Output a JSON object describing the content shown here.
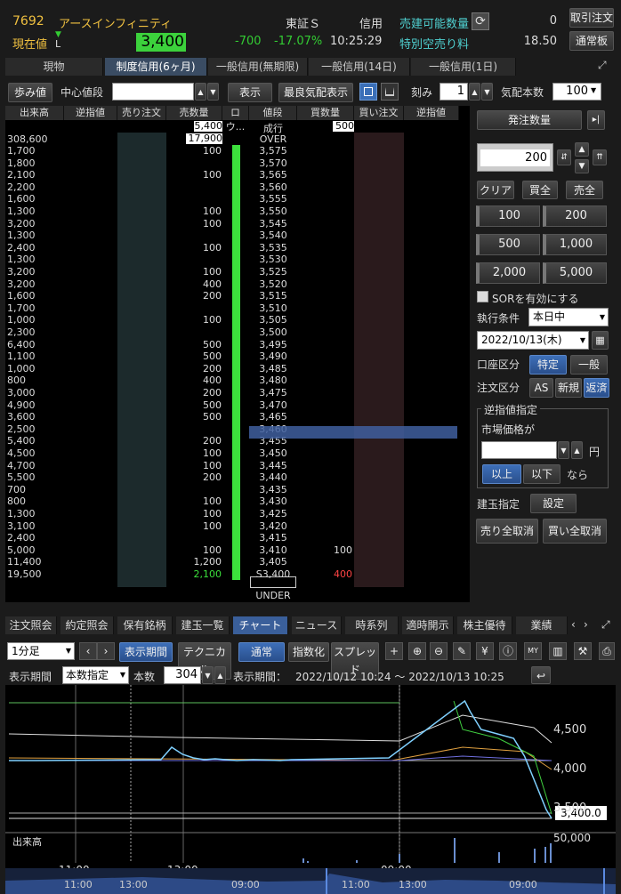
{
  "header": {
    "code": "7692",
    "name": "アースインフィニティ",
    "market": "東証Ｓ",
    "type": "信用",
    "sellable_label": "売建可能数量",
    "sellable_value": "0",
    "fee_label": "特別空売り料",
    "fee_value": "18.50",
    "price_label": "現在値",
    "price_flag": "L",
    "price": "3,400",
    "change": "-700",
    "change_pct": "-17.07%",
    "time": "10:25:29",
    "btn_trade": "取引注文",
    "btn_normal": "通常板"
  },
  "tabs": [
    "現物",
    "制度信用(6ヶ月)",
    "一般信用(無期限)",
    "一般信用(14日)",
    "一般信用(1日)"
  ],
  "toolbar": {
    "ayumi": "歩み値",
    "center_label": "中心値段",
    "show": "表示",
    "best": "最良気配表示",
    "kizami": "刻み",
    "kizami_value": "1",
    "kehai": "気配本数",
    "kehai_value": "100"
  },
  "board": {
    "headers": [
      "出来高",
      "逆指値",
      "売り注文",
      "売数量",
      "ロウ...",
      "値段",
      "買数量",
      "買い注文",
      "逆指値"
    ],
    "top_sell": "5,400",
    "top_price": "成行",
    "top_buy": "500",
    "over_vol": "308,600",
    "over_qty": "17,900",
    "over_label": "OVER",
    "rows": [
      [
        "1,700",
        "100",
        "3,575",
        ""
      ],
      [
        "1,800",
        "",
        "3,570",
        ""
      ],
      [
        "2,100",
        "100",
        "3,565",
        ""
      ],
      [
        "2,200",
        "",
        "3,560",
        ""
      ],
      [
        "1,600",
        "",
        "3,555",
        ""
      ],
      [
        "1,300",
        "100",
        "3,550",
        ""
      ],
      [
        "3,200",
        "100",
        "3,545",
        ""
      ],
      [
        "1,300",
        "",
        "3,540",
        ""
      ],
      [
        "2,400",
        "100",
        "3,535",
        ""
      ],
      [
        "1,300",
        "",
        "3,530",
        ""
      ],
      [
        "3,200",
        "100",
        "3,525",
        ""
      ],
      [
        "3,200",
        "400",
        "3,520",
        ""
      ],
      [
        "1,600",
        "200",
        "3,515",
        ""
      ],
      [
        "1,700",
        "",
        "3,510",
        ""
      ],
      [
        "1,000",
        "100",
        "3,505",
        ""
      ],
      [
        "2,300",
        "",
        "3,500",
        ""
      ],
      [
        "6,400",
        "500",
        "3,495",
        ""
      ],
      [
        "1,100",
        "500",
        "3,490",
        ""
      ],
      [
        "1,000",
        "200",
        "3,485",
        ""
      ],
      [
        "800",
        "400",
        "3,480",
        ""
      ],
      [
        "3,000",
        "200",
        "3,475",
        ""
      ],
      [
        "4,900",
        "500",
        "3,470",
        ""
      ],
      [
        "3,600",
        "500",
        "3,465",
        ""
      ],
      [
        "2,500",
        "",
        "3,460",
        ""
      ],
      [
        "5,400",
        "200",
        "3,455",
        ""
      ],
      [
        "4,500",
        "100",
        "3,450",
        ""
      ],
      [
        "4,700",
        "100",
        "3,445",
        ""
      ],
      [
        "5,500",
        "200",
        "3,440",
        ""
      ],
      [
        "700",
        "",
        "3,435",
        ""
      ],
      [
        "800",
        "100",
        "3,430",
        ""
      ],
      [
        "1,300",
        "100",
        "3,425",
        ""
      ],
      [
        "3,100",
        "100",
        "3,420",
        ""
      ],
      [
        "2,400",
        "",
        "3,415",
        ""
      ],
      [
        "5,000",
        "100",
        "3,410",
        "100"
      ],
      [
        "11,400",
        "1,200",
        "3,405",
        ""
      ],
      [
        "19,500",
        "2,100",
        "S3,400",
        "400"
      ]
    ],
    "under_label": "UNDER"
  },
  "order": {
    "qty_label": "発注数量",
    "qty_value": "200",
    "clear": "クリア",
    "buy_all": "買全",
    "sell_all": "売全",
    "quick": [
      "100",
      "200",
      "500",
      "1,000",
      "2,000",
      "5,000"
    ],
    "sor": "SORを有効にする",
    "cond_label": "執行条件",
    "cond_value": "本日中",
    "date_value": "2022/10/13(木)",
    "account_label": "口座区分",
    "acc1": "特定",
    "acc2": "一般",
    "order_label": "注文区分",
    "ord1": "AS",
    "ord2": "新規",
    "ord3": "返済",
    "stop_title": "逆指値指定",
    "stop_market": "市場価格が",
    "yen": "円",
    "above": "以上",
    "below": "以下",
    "nara": "なら",
    "pos_label": "建玉指定",
    "setting": "設定",
    "sell_cancel": "売り全取消",
    "buy_cancel": "買い全取消"
  },
  "bottom_tabs": [
    "注文照会",
    "約定照会",
    "保有銘柄",
    "建玉一覧",
    "チャート",
    "ニュース",
    "時系列",
    "適時開示",
    "株主優待",
    "業績"
  ],
  "chart_toolbar": {
    "interval": "1分足",
    "period_btn": "表示期間",
    "tech": "テクニカル",
    "normal": "通常",
    "index": "指数化",
    "spread": "スプレッド"
  },
  "chart_range": {
    "label": "表示期間",
    "mode": "本数指定",
    "count_label": "本数",
    "count": "304",
    "range_label": "表示期間：",
    "range": "2022/10/12 10:24 ～ 2022/10/13 10:25"
  },
  "chart_data": {
    "type": "line",
    "y_ticks": [
      "4,500",
      "4,000",
      "3,500"
    ],
    "last_price": "3,400.0",
    "volume_label": "出来高",
    "volume_tick": "50,000",
    "x_ticks_main": [
      "11:00",
      "13:00",
      "09:00"
    ],
    "x_ticks_nav": [
      "11:00",
      "13:00",
      "09:00",
      "11:00",
      "13:00",
      "09:00"
    ],
    "ylim": [
      3300,
      4900
    ],
    "price": [
      [
        0,
        4050
      ],
      [
        0.05,
        4050
      ],
      [
        0.28,
        4060
      ],
      [
        0.3,
        4200
      ],
      [
        0.32,
        4120
      ],
      [
        0.34,
        4080
      ],
      [
        0.36,
        4060
      ],
      [
        0.38,
        4070
      ],
      [
        0.42,
        4050
      ],
      [
        0.45,
        4060
      ],
      [
        0.48,
        4055
      ],
      [
        0.5,
        4050
      ],
      [
        0.52,
        4060
      ],
      [
        0.7,
        4080
      ],
      [
        0.84,
        4720
      ],
      [
        0.85,
        4600
      ],
      [
        0.87,
        4400
      ],
      [
        0.9,
        4350
      ],
      [
        0.93,
        4300
      ],
      [
        0.95,
        4100
      ],
      [
        0.97,
        3800
      ],
      [
        0.99,
        3500
      ],
      [
        1,
        3400
      ]
    ]
  }
}
